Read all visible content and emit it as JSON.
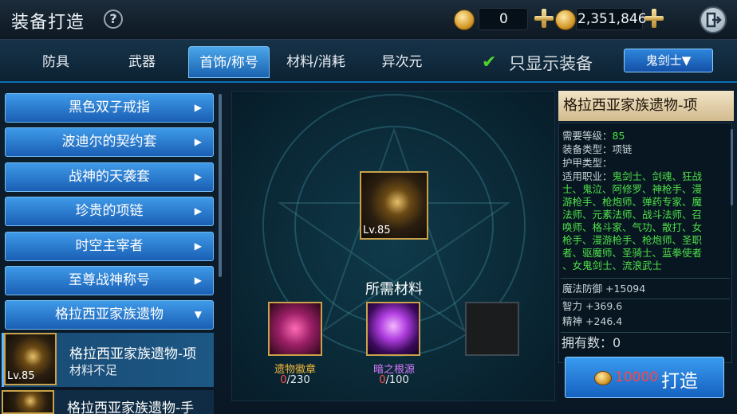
{
  "header": {
    "title": "装备打造",
    "help_icon": "?",
    "coin_count": "0",
    "gold_amount": "2,351,846"
  },
  "tabs": [
    "防具",
    "武器",
    "首饰/称号",
    "材料/消耗",
    "异次元"
  ],
  "active_tab": "首饰/称号",
  "filter": {
    "label": "只显示装备",
    "checked": true
  },
  "class_select": "鬼剑士▼",
  "left_items": [
    {
      "label": "黑色双子戒指",
      "arrow": "▶"
    },
    {
      "label": "波迪尔的契约套",
      "arrow": "▶"
    },
    {
      "label": "战神的天袭套",
      "arrow": "▶"
    },
    {
      "label": "珍贵的项链",
      "arrow": "▶"
    },
    {
      "label": "时空主宰者",
      "arrow": "▶"
    },
    {
      "label": "至尊战神称号",
      "arrow": "▶"
    },
    {
      "label": "格拉西亚家族遗物",
      "arrow": "▼"
    }
  ],
  "selected_item": {
    "name": "格拉西亚家族遗物-项",
    "status": "材料不足",
    "level": "Lv.85"
  },
  "next_item": {
    "name": "格拉西亚家族遗物-手"
  },
  "center": {
    "item_level": "Lv.85",
    "required_title": "所需材料",
    "materials": [
      {
        "name": "遗物徽章",
        "have": "0",
        "need": "/230",
        "color": "#f0b83a"
      },
      {
        "name": "暗之根源",
        "have": "0",
        "need": "/100",
        "color": "#d879ff"
      }
    ]
  },
  "detail": {
    "title": "格拉西亚家族遗物-项",
    "req_level_label": "需要等级：",
    "req_level": "85",
    "type_label": "装备类型：",
    "type": "项链",
    "armor_label": "护甲类型：",
    "class_label": "适用职业：",
    "classes": [
      "鬼剑士、剑魂、狂战",
      "士、鬼泣、阿修罗、神枪手、漫",
      "游枪手、枪炮师、弹药专家、魔",
      "法师、元素法师、战斗法师、召",
      "唤师、格斗家、气功、散打、女",
      "枪手、漫游枪手、枪炮师、圣职",
      "者、驱魔师、圣骑士、蓝拳使者",
      "、女鬼剑士、流浪武士"
    ],
    "magic_def": "魔法防御 +15094",
    "int": "智力 +369.6",
    "spirit": "精神 +246.4",
    "owned": "拥有数：0"
  },
  "craft": {
    "cost": "10000",
    "label": "打造"
  }
}
